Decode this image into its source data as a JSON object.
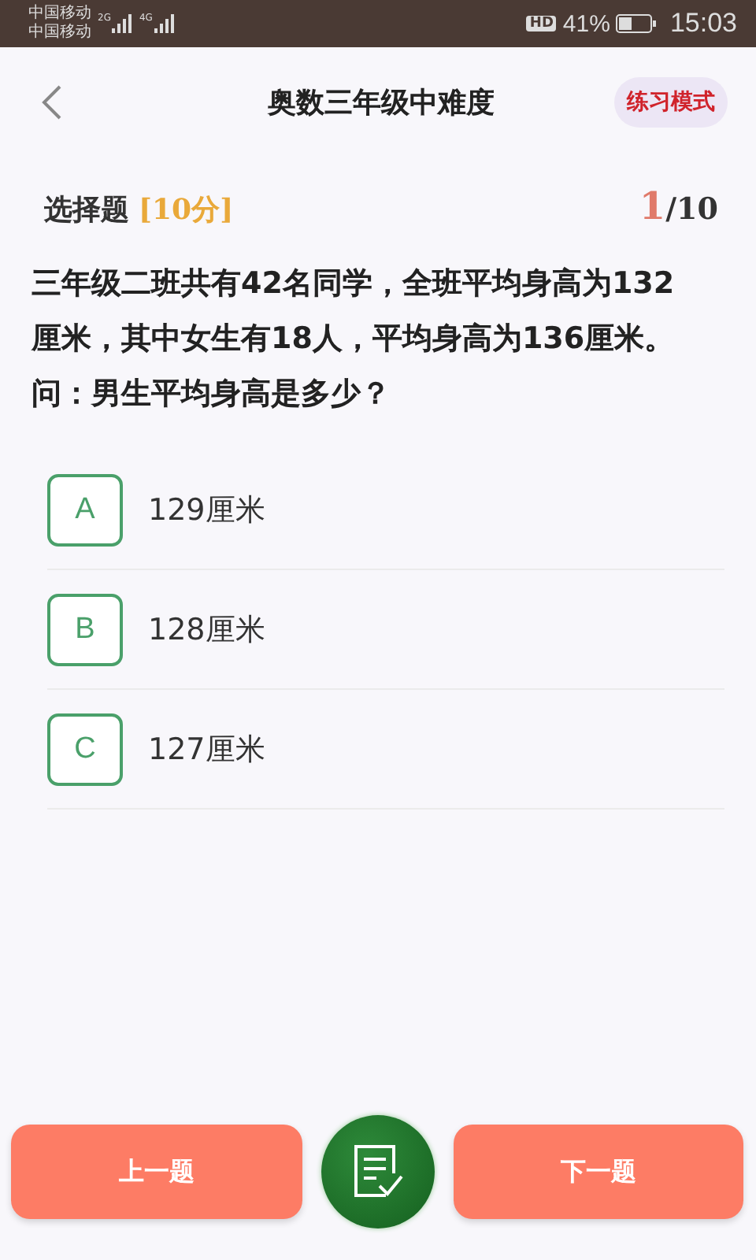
{
  "status_bar": {
    "carriers": [
      "中国移动",
      "中国移动"
    ],
    "networks": [
      "2G",
      "4G"
    ],
    "hd": "HD",
    "battery_text": "41%",
    "time": "15:03"
  },
  "header": {
    "title": "奥数三年级中难度",
    "mode": "练习模式"
  },
  "question": {
    "type": "选择题",
    "score": "[10分]",
    "current": "1",
    "total": "/10",
    "text": "三年级二班共有42名同学，全班平均身高为132厘米，其中女生有18人，平均身高为136厘米。问：男生平均身高是多少？"
  },
  "options": [
    {
      "letter": "A",
      "text": "129厘米"
    },
    {
      "letter": "B",
      "text": "128厘米"
    },
    {
      "letter": "C",
      "text": "127厘米"
    }
  ],
  "footer": {
    "prev": "上一题",
    "next": "下一题"
  }
}
